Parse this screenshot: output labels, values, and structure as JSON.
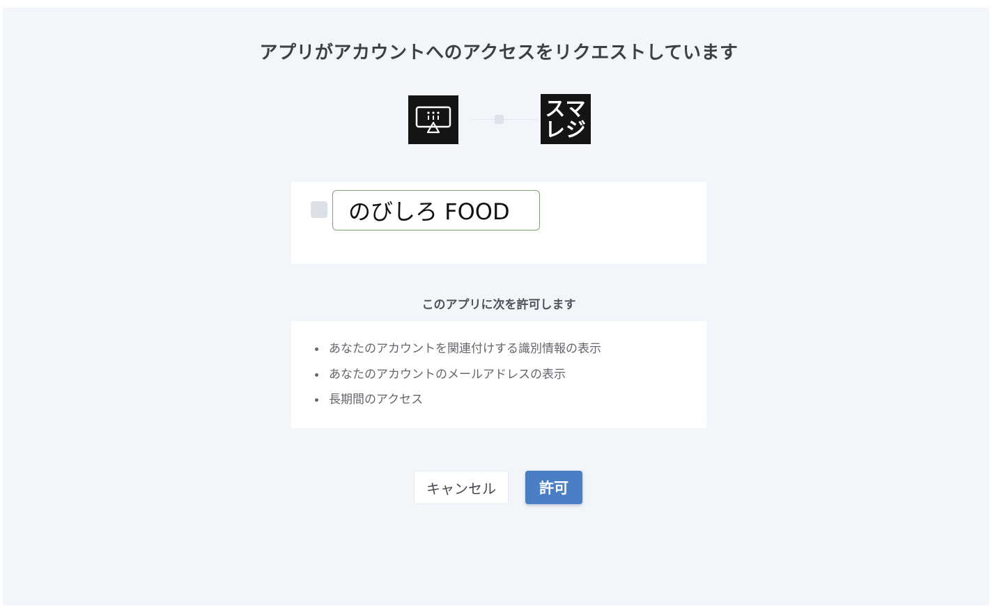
{
  "page": {
    "title": "アプリがアカウントへのアクセスをリクエストしています"
  },
  "logos": {
    "app_icon": "monitor-icon",
    "service_logo_line1": "スマ",
    "service_logo_line2": "レジ"
  },
  "account": {
    "name": "のびしろ FOOD",
    "checked": false
  },
  "permissions": {
    "heading": "このアプリに次を許可します",
    "items": [
      "あなたのアカウントを関連付けする識別情報の表示",
      "あなたのアカウントのメールアドレスの表示",
      "長期間のアクセス"
    ]
  },
  "actions": {
    "cancel_label": "キャンセル",
    "allow_label": "許可"
  },
  "colors": {
    "background": "#f2f5f9",
    "primary_button": "#4a7fc6",
    "highlight_border": "#79a86b"
  }
}
